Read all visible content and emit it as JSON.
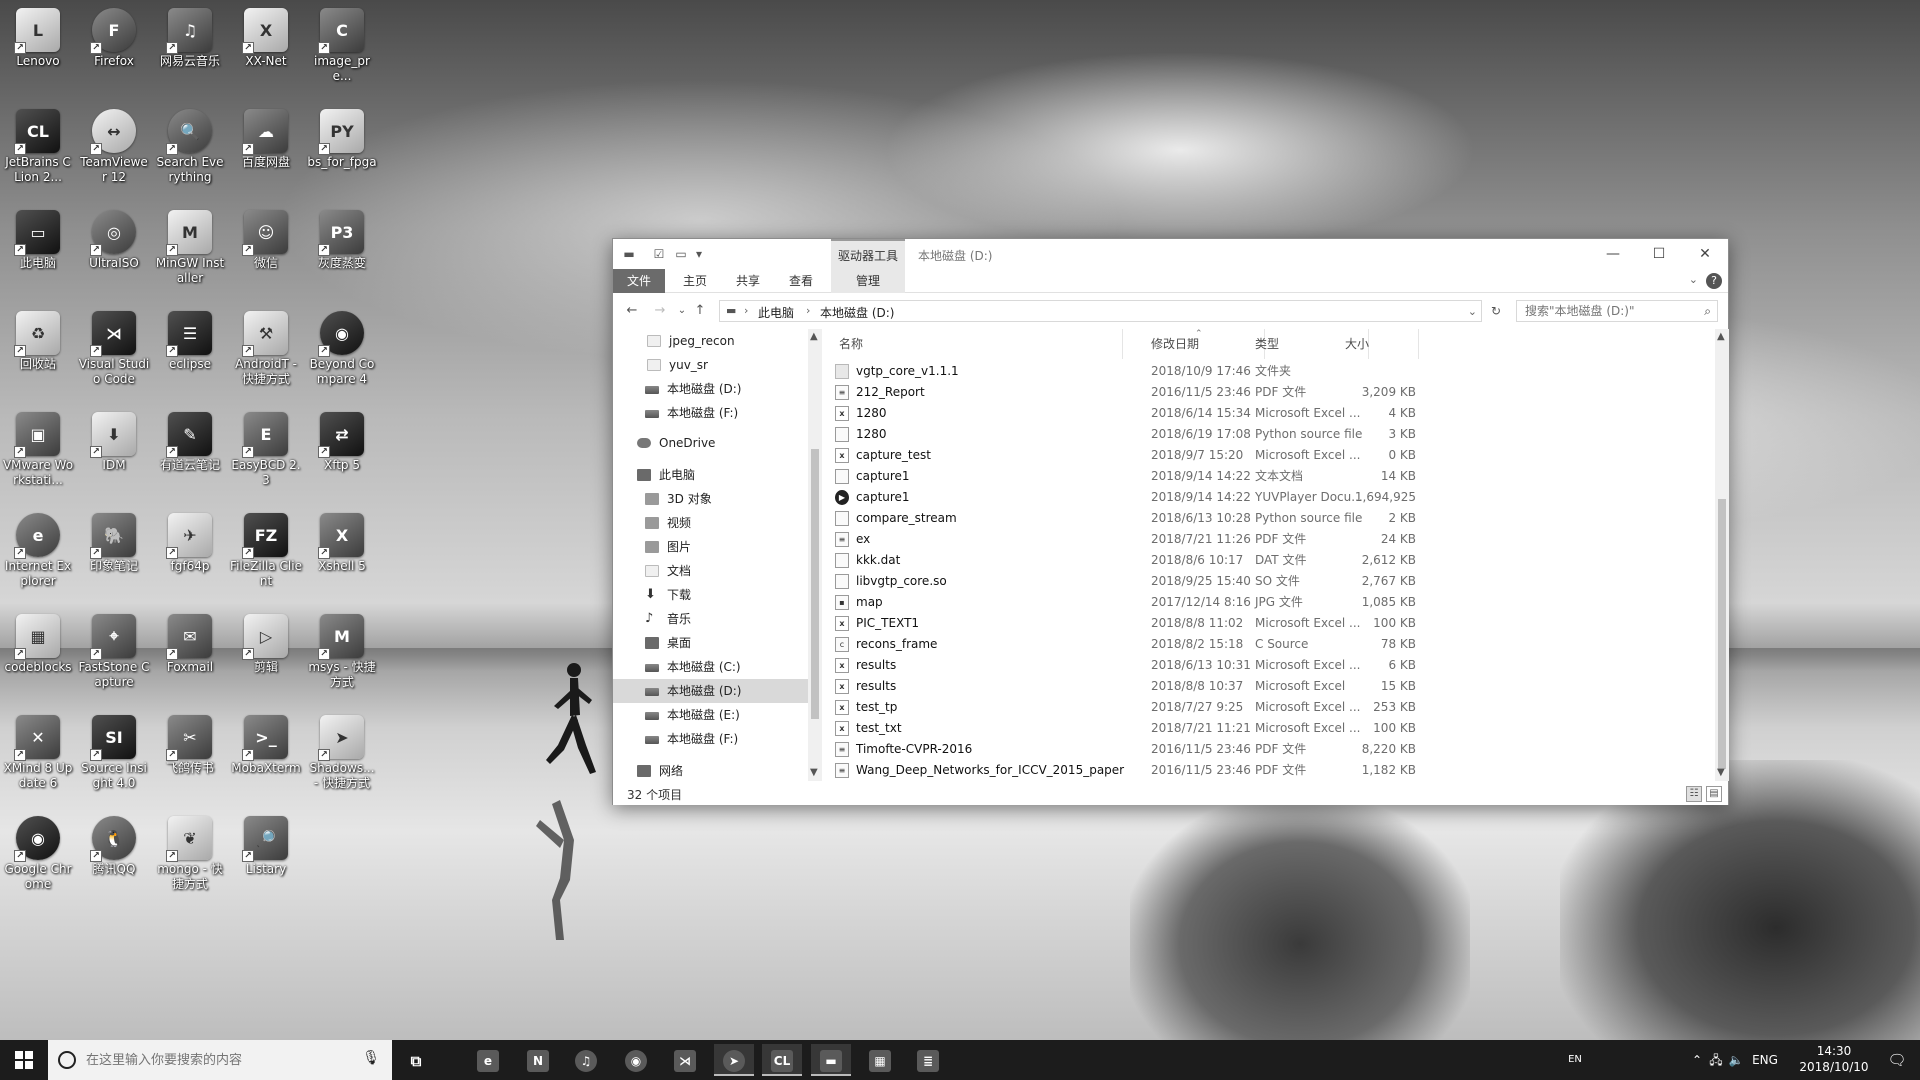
{
  "desktop": {
    "icons": [
      {
        "label": "Lenovo",
        "icon": "lenovo-icon",
        "glyph": "L"
      },
      {
        "label": "Firefox",
        "icon": "firefox-icon",
        "glyph": "F"
      },
      {
        "label": "网易云音乐",
        "icon": "netease-music-icon",
        "glyph": "♫"
      },
      {
        "label": "XX-Net",
        "icon": "xx-net-icon",
        "glyph": "X"
      },
      {
        "label": "image_pre...",
        "icon": "file-icon",
        "glyph": "C"
      },
      {
        "label": "JetBrains CLion 2...",
        "icon": "clion-icon",
        "glyph": "CL"
      },
      {
        "label": "TeamViewer 12",
        "icon": "teamviewer-icon",
        "glyph": "↔"
      },
      {
        "label": "Search Everything",
        "icon": "search-everything-icon",
        "glyph": "🔍"
      },
      {
        "label": "百度网盘",
        "icon": "baidu-netdisk-icon",
        "glyph": "☁"
      },
      {
        "label": "bs_for_fpga",
        "icon": "python-file-icon",
        "glyph": "PY"
      },
      {
        "label": "此电脑",
        "icon": "this-pc-icon",
        "glyph": "▭"
      },
      {
        "label": "UltraISO",
        "icon": "ultraiso-icon",
        "glyph": "◎"
      },
      {
        "label": "MinGW Installer",
        "icon": "mingw-icon",
        "glyph": "M"
      },
      {
        "label": "微信",
        "icon": "wechat-icon",
        "glyph": "☺"
      },
      {
        "label": "灰度蒸变",
        "icon": "app-icon",
        "glyph": "P3"
      },
      {
        "label": "回收站",
        "icon": "recycle-bin-icon",
        "glyph": "♻"
      },
      {
        "label": "Visual Studio Code",
        "icon": "vscode-icon",
        "glyph": "⋊"
      },
      {
        "label": "eclipse",
        "icon": "eclipse-icon",
        "glyph": "☰"
      },
      {
        "label": "AndroidT - 快捷方式",
        "icon": "android-tool-icon",
        "glyph": "⚒"
      },
      {
        "label": "Beyond Compare 4",
        "icon": "beyond-compare-icon",
        "glyph": "◉"
      },
      {
        "label": "VMware Workstati...",
        "icon": "vmware-icon",
        "glyph": "▣"
      },
      {
        "label": "IDM",
        "icon": "idm-icon",
        "glyph": "⬇"
      },
      {
        "label": "有道云笔记",
        "icon": "youdao-note-icon",
        "glyph": "✎"
      },
      {
        "label": "EasyBCD 2.3",
        "icon": "easybcd-icon",
        "glyph": "E"
      },
      {
        "label": "Xftp 5",
        "icon": "xftp-icon",
        "glyph": "⇄"
      },
      {
        "label": "Internet Explorer",
        "icon": "internet-explorer-icon",
        "glyph": "e"
      },
      {
        "label": "印象笔记",
        "icon": "evernote-icon",
        "glyph": "🐘"
      },
      {
        "label": "fgf64p",
        "icon": "app-icon",
        "glyph": "✈"
      },
      {
        "label": "FileZilla Client",
        "icon": "filezilla-icon",
        "glyph": "FZ"
      },
      {
        "label": "Xshell 5",
        "icon": "xshell-icon",
        "glyph": "X"
      },
      {
        "label": "codeblocks",
        "icon": "codeblocks-icon",
        "glyph": "▦"
      },
      {
        "label": "FastStone Capture",
        "icon": "faststone-icon",
        "glyph": "⌖"
      },
      {
        "label": "Foxmail",
        "icon": "foxmail-icon",
        "glyph": "✉"
      },
      {
        "label": "剪辑",
        "icon": "video-editor-icon",
        "glyph": "▷"
      },
      {
        "label": "msys - 快捷方式",
        "icon": "msys-icon",
        "glyph": "M"
      },
      {
        "label": "XMind 8 Update 6",
        "icon": "xmind-icon",
        "glyph": "✕"
      },
      {
        "label": "Source Insight 4.0",
        "icon": "source-insight-icon",
        "glyph": "SI"
      },
      {
        "label": "飞鸽传书",
        "icon": "feige-icon",
        "glyph": "✂"
      },
      {
        "label": "MobaXterm",
        "icon": "mobaxterm-icon",
        "glyph": ">_"
      },
      {
        "label": "Shadows... - 快捷方式",
        "icon": "shadowsocks-icon",
        "glyph": "➤"
      },
      {
        "label": "Google Chrome",
        "icon": "chrome-icon",
        "glyph": "◉"
      },
      {
        "label": "腾讯QQ",
        "icon": "qq-icon",
        "glyph": "🐧"
      },
      {
        "label": "mongo - 快捷方式",
        "icon": "mongodb-icon",
        "glyph": "❦"
      },
      {
        "label": "Listary",
        "icon": "listary-icon",
        "glyph": "🔎"
      }
    ]
  },
  "explorer": {
    "context_tab": "驱动器工具",
    "title": "本地磁盘 (D:)",
    "window_buttons": {
      "minimize": "—",
      "maximize": "☐",
      "close": "✕"
    },
    "ribbon_tabs": {
      "file": "文件",
      "home": "主页",
      "share": "共享",
      "view": "查看",
      "manage": "管理"
    },
    "address": {
      "part1": "此电脑",
      "part2": "本地磁盘 (D:)"
    },
    "search_placeholder": "搜索\"本地磁盘 (D:)\"",
    "nav_items": [
      {
        "label": "jpeg_recon",
        "icon": "folder-icon"
      },
      {
        "label": "yuv_sr",
        "icon": "folder-icon"
      },
      {
        "label": "本地磁盘 (D:)",
        "icon": "drive-icon"
      },
      {
        "label": "本地磁盘 (F:)",
        "icon": "drive-icon"
      },
      {
        "label": "OneDrive",
        "icon": "onedrive-icon"
      },
      {
        "label": "此电脑",
        "icon": "this-pc-icon"
      },
      {
        "label": "3D 对象",
        "icon": "3d-objects-icon"
      },
      {
        "label": "视频",
        "icon": "videos-icon"
      },
      {
        "label": "图片",
        "icon": "pictures-icon"
      },
      {
        "label": "文档",
        "icon": "documents-icon"
      },
      {
        "label": "下载",
        "icon": "downloads-icon"
      },
      {
        "label": "音乐",
        "icon": "music-icon"
      },
      {
        "label": "桌面",
        "icon": "desktop-folder-icon"
      },
      {
        "label": "本地磁盘 (C:)",
        "icon": "drive-icon"
      },
      {
        "label": "本地磁盘 (D:)",
        "icon": "drive-icon"
      },
      {
        "label": "本地磁盘 (E:)",
        "icon": "drive-icon"
      },
      {
        "label": "本地磁盘 (F:)",
        "icon": "drive-icon"
      },
      {
        "label": "网络",
        "icon": "network-icon"
      }
    ],
    "columns": {
      "name": "名称",
      "date": "修改日期",
      "type": "类型",
      "size": "大小"
    },
    "files": [
      {
        "name": "vgtp_core_v1.1.1",
        "date": "2018/10/9 17:46",
        "type": "文件夹",
        "size": "",
        "icon": "folder-icon",
        "glyph": ""
      },
      {
        "name": "212_Report",
        "date": "2016/11/5 23:46",
        "type": "PDF 文件",
        "size": "3,209 KB",
        "icon": "pdf-icon",
        "glyph": "≡"
      },
      {
        "name": "1280",
        "date": "2018/6/14 15:34",
        "type": "Microsoft Excel ...",
        "size": "4 KB",
        "icon": "excel-icon",
        "glyph": "x"
      },
      {
        "name": "1280",
        "date": "2018/6/19 17:08",
        "type": "Python source file",
        "size": "3 KB",
        "icon": "python-file-icon",
        "glyph": ""
      },
      {
        "name": "capture_test",
        "date": "2018/9/7 15:20",
        "type": "Microsoft Excel ...",
        "size": "0 KB",
        "icon": "excel-icon",
        "glyph": "x"
      },
      {
        "name": "capture1",
        "date": "2018/9/14 14:22",
        "type": "文本文档",
        "size": "14 KB",
        "icon": "text-file-icon",
        "glyph": ""
      },
      {
        "name": "capture1",
        "date": "2018/9/14 14:22",
        "type": "YUVPlayer Docu...",
        "size": "1,694,925",
        "icon": "yuvplayer-icon",
        "glyph": "▶"
      },
      {
        "name": "compare_stream",
        "date": "2018/6/13 10:28",
        "type": "Python source file",
        "size": "2 KB",
        "icon": "python-file-icon",
        "glyph": ""
      },
      {
        "name": "ex",
        "date": "2018/7/21 11:26",
        "type": "PDF 文件",
        "size": "24 KB",
        "icon": "pdf-icon",
        "glyph": "≡"
      },
      {
        "name": "kkk.dat",
        "date": "2018/8/6 10:17",
        "type": "DAT 文件",
        "size": "2,612 KB",
        "icon": "file-icon",
        "glyph": ""
      },
      {
        "name": "libvgtp_core.so",
        "date": "2018/9/25 15:40",
        "type": "SO 文件",
        "size": "2,767 KB",
        "icon": "file-icon",
        "glyph": ""
      },
      {
        "name": "map",
        "date": "2017/12/14 8:16",
        "type": "JPG 文件",
        "size": "1,085 KB",
        "icon": "image-file-icon",
        "glyph": "▪"
      },
      {
        "name": "PIC_TEXT1",
        "date": "2018/8/8 11:02",
        "type": "Microsoft Excel ...",
        "size": "100 KB",
        "icon": "excel-icon",
        "glyph": "x"
      },
      {
        "name": "recons_frame",
        "date": "2018/8/2 15:18",
        "type": "C Source",
        "size": "78 KB",
        "icon": "c-source-icon",
        "glyph": "c"
      },
      {
        "name": "results",
        "date": "2018/6/13 10:31",
        "type": "Microsoft Excel ...",
        "size": "6 KB",
        "icon": "excel-icon",
        "glyph": "x"
      },
      {
        "name": "results",
        "date": "2018/8/8 10:37",
        "type": "Microsoft Excel",
        "size": "15 KB",
        "icon": "excel-icon",
        "glyph": "x"
      },
      {
        "name": "test_tp",
        "date": "2018/7/27 9:25",
        "type": "Microsoft Excel ...",
        "size": "253 KB",
        "icon": "excel-icon",
        "glyph": "x"
      },
      {
        "name": "test_txt",
        "date": "2018/7/21 11:21",
        "type": "Microsoft Excel ...",
        "size": "100 KB",
        "icon": "excel-icon",
        "glyph": "x"
      },
      {
        "name": "Timofte-CVPR-2016",
        "date": "2016/11/5 23:46",
        "type": "PDF 文件",
        "size": "8,220 KB",
        "icon": "pdf-icon",
        "glyph": "≡"
      },
      {
        "name": "Wang_Deep_Networks_for_ICCV_2015_paper",
        "date": "2016/11/5 23:46",
        "type": "PDF 文件",
        "size": "1,182 KB",
        "icon": "pdf-icon",
        "glyph": "≡"
      }
    ],
    "status": "32 个项目"
  },
  "taskbar": {
    "search_placeholder": "在这里输入你要搜索的内容",
    "apps": [
      {
        "name": "task-view-icon",
        "glyph": "⧉"
      },
      {
        "name": "edge-icon",
        "glyph": "e"
      },
      {
        "name": "onenote-icon",
        "glyph": "N"
      },
      {
        "name": "netease-music-icon",
        "glyph": "♫"
      },
      {
        "name": "chrome-icon",
        "glyph": "◉"
      },
      {
        "name": "vscode-icon",
        "glyph": "⋊"
      },
      {
        "name": "shadowsocks-icon",
        "glyph": "➤"
      },
      {
        "name": "clion-icon",
        "glyph": "CL"
      },
      {
        "name": "file-explorer-icon",
        "glyph": "▬"
      },
      {
        "name": "video-icon",
        "glyph": "▦"
      },
      {
        "name": "document-icon",
        "glyph": "≣"
      }
    ],
    "ime": "EN",
    "lang": "ENG",
    "time": "14:30",
    "date": "2018/10/10"
  }
}
